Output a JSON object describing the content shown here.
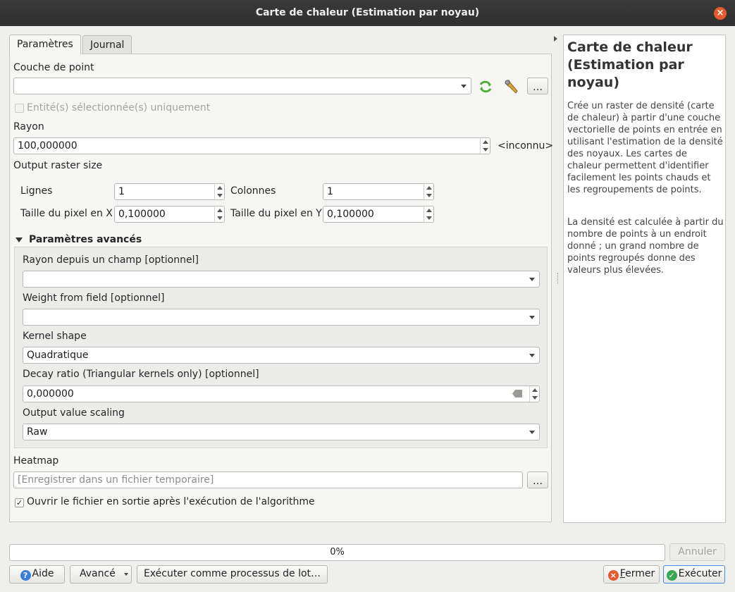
{
  "window": {
    "title": "Carte de chaleur (Estimation par noyau)"
  },
  "tabs": [
    {
      "label": "Paramètres"
    },
    {
      "label": "Journal"
    }
  ],
  "params": {
    "point_layer_label": "Couche de point",
    "point_layer_value": "",
    "selected_only_label": "Entité(s) sélectionnée(s) uniquement",
    "radius_label": "Rayon",
    "radius_value": "100,000000",
    "radius_unit": "<inconnu>",
    "raster_size_label": "Output raster size",
    "rows_label": "Lignes",
    "rows_value": "1",
    "cols_label": "Colonnes",
    "cols_value": "1",
    "pixel_x_label": "Taille du pixel en X",
    "pixel_x_value": "0,100000",
    "pixel_y_label": "Taille du pixel en Y",
    "pixel_y_value": "0,100000",
    "browse_label": "…"
  },
  "advanced": {
    "section_label": "Paramètres avancés",
    "radius_field_label": "Rayon depuis un champ [optionnel]",
    "radius_field_value": "",
    "weight_field_label": "Weight from field [optionnel]",
    "weight_field_value": "",
    "kernel_label": "Kernel shape",
    "kernel_value": "Quadratique",
    "decay_label": "Decay ratio (Triangular kernels only) [optionnel]",
    "decay_value": "0,000000",
    "scaling_label": "Output value scaling",
    "scaling_value": "Raw"
  },
  "output": {
    "heatmap_label": "Heatmap",
    "heatmap_placeholder": "[Enregistrer dans un fichier temporaire]",
    "browse_label": "…",
    "open_after_label": "Ouvrir le fichier en sortie après l'exécution de l'algorithme",
    "open_after_checked": true
  },
  "help": {
    "title": "Carte de chaleur (Estimation par noyau)",
    "para1": "Crée un raster de densité (carte de chaleur) à partir d'une couche vectorielle de points en entrée en utilisant l'estimation de la densité des noyaux. Les cartes de chaleur permettent d'identifier facilement les points chauds et les regroupements de points.",
    "para2": "La densité est calculée à partir du nombre de points à un endroit donné ; un grand nombre de points regroupés donne des valeurs plus élevées."
  },
  "progress": {
    "text": "0%",
    "value": 0
  },
  "buttons": {
    "cancel": "Annuler",
    "help": "Aide",
    "advanced": "Avancé",
    "batch": "Exécuter comme processus de lot…",
    "close_mnemonic": "F",
    "close_rest": "ermer",
    "run": "Exécuter"
  },
  "colors": {
    "title_bar": "#2f2f2f",
    "close_red": "#e35b2e",
    "run_green": "#3aa655",
    "help_blue": "#3b7dd8"
  }
}
